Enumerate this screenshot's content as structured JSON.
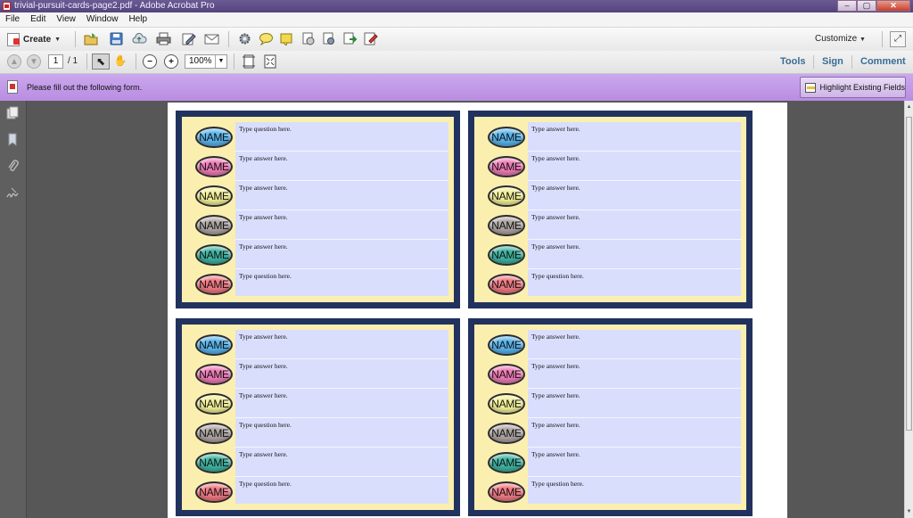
{
  "window": {
    "title": "trivial-pursuit-cards-page2.pdf - Adobe Acrobat Pro",
    "minimize": "–",
    "maximize": "▢",
    "close": "✕"
  },
  "menu": [
    "File",
    "Edit",
    "View",
    "Window",
    "Help"
  ],
  "toolbar": {
    "create_label": "Create",
    "customize_label": "Customize",
    "icons": [
      "open-folder-icon",
      "save-icon",
      "cloud-upload-icon",
      "print-icon",
      "edit-icon",
      "email-icon",
      "gear-icon",
      "comment-icon",
      "sticky-note-icon",
      "stamp-icon",
      "document-settings-icon",
      "export-icon",
      "sign-doc-icon"
    ]
  },
  "nav": {
    "page_current": "1",
    "page_total": "/ 1",
    "zoom": "100%",
    "tools_label": "Tools",
    "sign_label": "Sign",
    "comment_label": "Comment"
  },
  "form_bar": {
    "message": "Please fill out the following form.",
    "highlight_button": "Highlight Existing Fields"
  },
  "badge_label": "NAME",
  "badge_colors": [
    "#59b3ea",
    "#ee7bb6",
    "#f2ef98",
    "#ada5a2",
    "#3fb3a0",
    "#ef7982"
  ],
  "cards": [
    {
      "fields": [
        "Type question here.",
        "Type answer here.",
        "Type answer here.",
        "Type answer here.",
        "Type answer here.",
        "Type question here."
      ]
    },
    {
      "fields": [
        "Type answer here.",
        "Type answer here.",
        "Type answer here.",
        "Type answer here.",
        "Type answer here.",
        "Type question here."
      ]
    },
    {
      "fields": [
        "Type answer here.",
        "Type answer here.",
        "Type answer here.",
        "Type question here.",
        "Type answer here.",
        "Type question here."
      ]
    },
    {
      "fields": [
        "Type answer here.",
        "Type answer here.",
        "Type answer here.",
        "Type answer here.",
        "Type answer here.",
        "Type question here."
      ]
    }
  ]
}
